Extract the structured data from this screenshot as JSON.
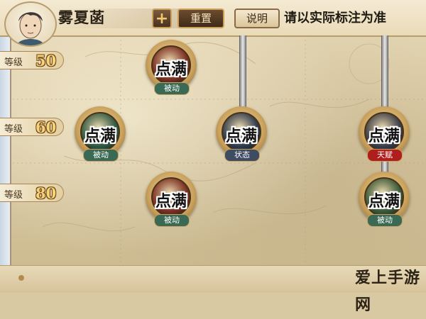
{
  "header": {
    "hero_name": "雾夏菡",
    "plus_label": "+",
    "reset_label": "重置",
    "info_label": "说明",
    "note": "请以实际标注为准"
  },
  "levels": [
    {
      "label": "等级",
      "value": "50"
    },
    {
      "label": "等级",
      "value": "60"
    },
    {
      "label": "等级",
      "value": "80"
    }
  ],
  "skills": [
    {
      "status": "点满",
      "badge": "被动",
      "core_color": "#7a2f24",
      "badge_color": "#3a6a55"
    },
    {
      "status": "点满",
      "badge": "被动",
      "core_color": "#2e5a44",
      "badge_color": "#3a6a55"
    },
    {
      "status": "点满",
      "badge": "状态",
      "core_color": "#2d3c4f",
      "badge_color": "#3d4b63"
    },
    {
      "status": "点满",
      "badge": "天赋",
      "core_color": "#3b3f4a",
      "badge_color": "#b01d1d"
    },
    {
      "status": "点满",
      "badge": "被动",
      "core_color": "#7a2f24",
      "badge_color": "#3a6a55"
    },
    {
      "status": "点满",
      "badge": "被动",
      "core_color": "#3a5a3a",
      "badge_color": "#3a6a55"
    }
  ],
  "watermark": "爱上手游网"
}
